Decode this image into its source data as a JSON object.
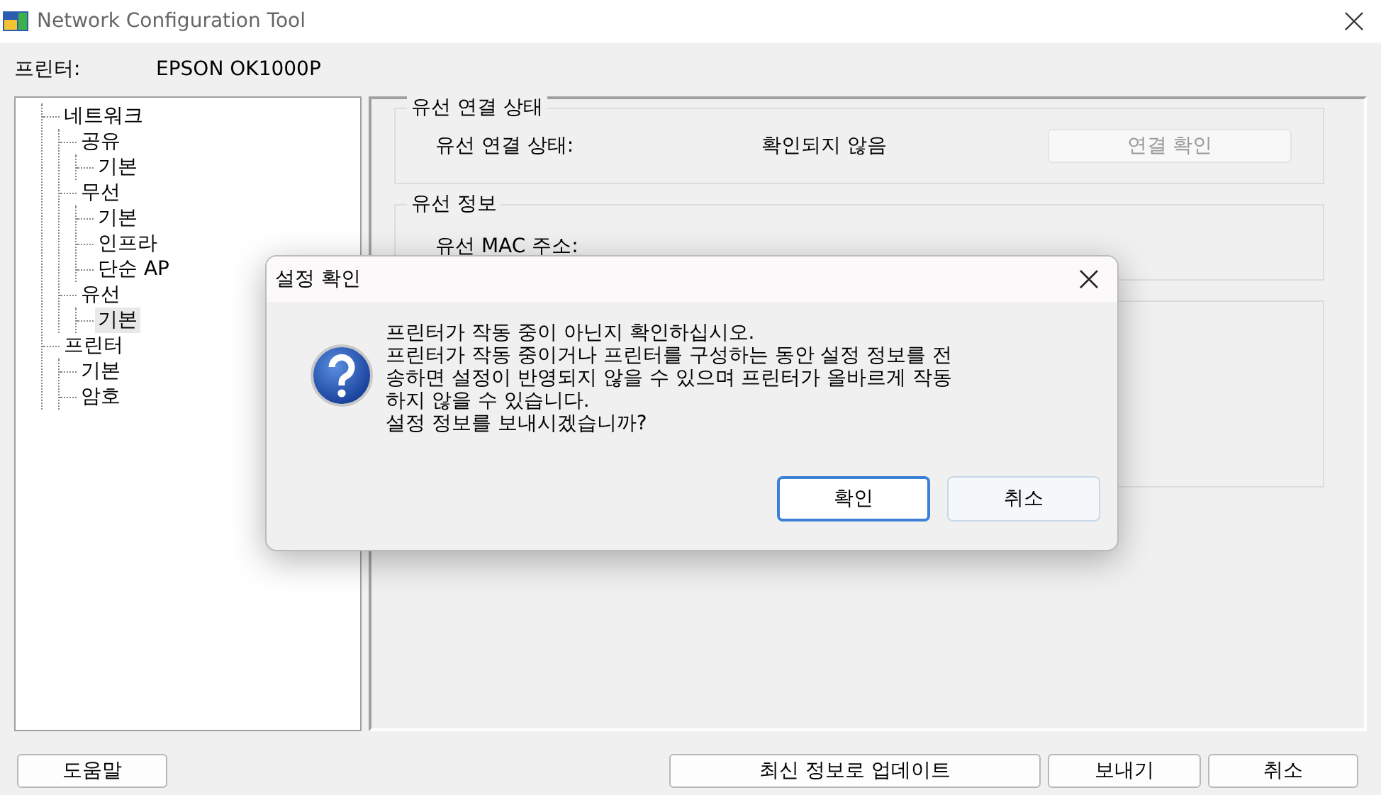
{
  "window": {
    "title": "Network Configuration Tool"
  },
  "printer": {
    "label": "프린터:",
    "value": "EPSON OK1000P"
  },
  "tree": [
    {
      "label": "네트워크",
      "selected": false,
      "children": [
        {
          "label": "공유",
          "selected": false,
          "children": [
            {
              "label": "기본",
              "selected": false
            }
          ]
        },
        {
          "label": "무선",
          "selected": false,
          "children": [
            {
              "label": "기본",
              "selected": false
            },
            {
              "label": "인프라",
              "selected": false
            },
            {
              "label": "단순 AP",
              "selected": false
            }
          ]
        },
        {
          "label": "유선",
          "selected": false,
          "children": [
            {
              "label": "기본",
              "selected": true
            }
          ]
        }
      ]
    },
    {
      "label": "프린터",
      "selected": false,
      "children": [
        {
          "label": "기본",
          "selected": false
        },
        {
          "label": "암호",
          "selected": false
        }
      ]
    }
  ],
  "groups": [
    {
      "title": "유선 연결 상태",
      "label": "유선 연결 상태:",
      "value": "확인되지 않음",
      "button": {
        "label": "연결 확인",
        "disabled": true
      }
    },
    {
      "title": "유선 정보",
      "label": "유선 MAC 주소:"
    }
  ],
  "dialog": {
    "title": "설정 확인",
    "message": [
      "프린터가 작동 중이 아닌지 확인하십시오.",
      "프린터가 작동 중이거나 프린터를 구성하는 동안 설정 정보를 전",
      "송하면 설정이 반영되지 않을 수 있으며 프린터가 올바르게 작동",
      "하지 않을 수 있습니다.",
      "설정 정보를 보내시겠습니까?"
    ],
    "buttons": [
      {
        "label": "확인",
        "default": true
      },
      {
        "label": "취소",
        "default": false
      }
    ]
  },
  "footer": {
    "help": "도움말",
    "buttons": [
      "최신 정보로 업데이트",
      "보내기",
      "취소"
    ]
  }
}
